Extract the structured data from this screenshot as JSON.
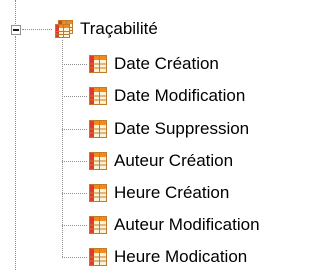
{
  "tree": {
    "root": {
      "label": "Traçabilité",
      "icon": "table-group-icon",
      "expanded": true
    },
    "items": [
      {
        "label": "Date Création",
        "icon": "table-field-icon"
      },
      {
        "label": "Date Modification",
        "icon": "table-field-icon"
      },
      {
        "label": "Date Suppression",
        "icon": "table-field-icon"
      },
      {
        "label": "Auteur Création",
        "icon": "table-field-icon"
      },
      {
        "label": "Heure Création",
        "icon": "table-field-icon"
      },
      {
        "label": "Auteur Modification",
        "icon": "table-field-icon"
      },
      {
        "label": "Heure Modication",
        "icon": "table-field-icon"
      }
    ]
  },
  "colors": {
    "connector": "#8c8c8c",
    "icon_orange": "#f08a1c",
    "icon_red": "#e23a2a",
    "icon_cream": "#fff3d6",
    "icon_border": "#c07a2c"
  }
}
